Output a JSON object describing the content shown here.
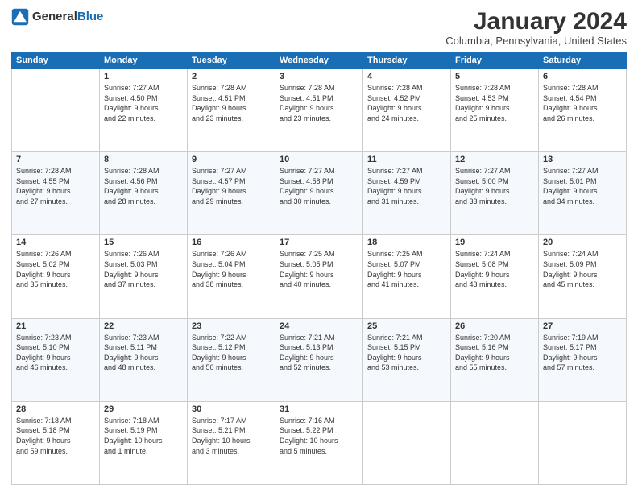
{
  "header": {
    "logo_general": "General",
    "logo_blue": "Blue",
    "title": "January 2024",
    "location": "Columbia, Pennsylvania, United States"
  },
  "weekdays": [
    "Sunday",
    "Monday",
    "Tuesday",
    "Wednesday",
    "Thursday",
    "Friday",
    "Saturday"
  ],
  "weeks": [
    [
      {
        "day": "",
        "info": ""
      },
      {
        "day": "1",
        "info": "Sunrise: 7:27 AM\nSunset: 4:50 PM\nDaylight: 9 hours\nand 22 minutes."
      },
      {
        "day": "2",
        "info": "Sunrise: 7:28 AM\nSunset: 4:51 PM\nDaylight: 9 hours\nand 23 minutes."
      },
      {
        "day": "3",
        "info": "Sunrise: 7:28 AM\nSunset: 4:51 PM\nDaylight: 9 hours\nand 23 minutes."
      },
      {
        "day": "4",
        "info": "Sunrise: 7:28 AM\nSunset: 4:52 PM\nDaylight: 9 hours\nand 24 minutes."
      },
      {
        "day": "5",
        "info": "Sunrise: 7:28 AM\nSunset: 4:53 PM\nDaylight: 9 hours\nand 25 minutes."
      },
      {
        "day": "6",
        "info": "Sunrise: 7:28 AM\nSunset: 4:54 PM\nDaylight: 9 hours\nand 26 minutes."
      }
    ],
    [
      {
        "day": "7",
        "info": "Sunrise: 7:28 AM\nSunset: 4:55 PM\nDaylight: 9 hours\nand 27 minutes."
      },
      {
        "day": "8",
        "info": "Sunrise: 7:28 AM\nSunset: 4:56 PM\nDaylight: 9 hours\nand 28 minutes."
      },
      {
        "day": "9",
        "info": "Sunrise: 7:27 AM\nSunset: 4:57 PM\nDaylight: 9 hours\nand 29 minutes."
      },
      {
        "day": "10",
        "info": "Sunrise: 7:27 AM\nSunset: 4:58 PM\nDaylight: 9 hours\nand 30 minutes."
      },
      {
        "day": "11",
        "info": "Sunrise: 7:27 AM\nSunset: 4:59 PM\nDaylight: 9 hours\nand 31 minutes."
      },
      {
        "day": "12",
        "info": "Sunrise: 7:27 AM\nSunset: 5:00 PM\nDaylight: 9 hours\nand 33 minutes."
      },
      {
        "day": "13",
        "info": "Sunrise: 7:27 AM\nSunset: 5:01 PM\nDaylight: 9 hours\nand 34 minutes."
      }
    ],
    [
      {
        "day": "14",
        "info": "Sunrise: 7:26 AM\nSunset: 5:02 PM\nDaylight: 9 hours\nand 35 minutes."
      },
      {
        "day": "15",
        "info": "Sunrise: 7:26 AM\nSunset: 5:03 PM\nDaylight: 9 hours\nand 37 minutes."
      },
      {
        "day": "16",
        "info": "Sunrise: 7:26 AM\nSunset: 5:04 PM\nDaylight: 9 hours\nand 38 minutes."
      },
      {
        "day": "17",
        "info": "Sunrise: 7:25 AM\nSunset: 5:05 PM\nDaylight: 9 hours\nand 40 minutes."
      },
      {
        "day": "18",
        "info": "Sunrise: 7:25 AM\nSunset: 5:07 PM\nDaylight: 9 hours\nand 41 minutes."
      },
      {
        "day": "19",
        "info": "Sunrise: 7:24 AM\nSunset: 5:08 PM\nDaylight: 9 hours\nand 43 minutes."
      },
      {
        "day": "20",
        "info": "Sunrise: 7:24 AM\nSunset: 5:09 PM\nDaylight: 9 hours\nand 45 minutes."
      }
    ],
    [
      {
        "day": "21",
        "info": "Sunrise: 7:23 AM\nSunset: 5:10 PM\nDaylight: 9 hours\nand 46 minutes."
      },
      {
        "day": "22",
        "info": "Sunrise: 7:23 AM\nSunset: 5:11 PM\nDaylight: 9 hours\nand 48 minutes."
      },
      {
        "day": "23",
        "info": "Sunrise: 7:22 AM\nSunset: 5:12 PM\nDaylight: 9 hours\nand 50 minutes."
      },
      {
        "day": "24",
        "info": "Sunrise: 7:21 AM\nSunset: 5:13 PM\nDaylight: 9 hours\nand 52 minutes."
      },
      {
        "day": "25",
        "info": "Sunrise: 7:21 AM\nSunset: 5:15 PM\nDaylight: 9 hours\nand 53 minutes."
      },
      {
        "day": "26",
        "info": "Sunrise: 7:20 AM\nSunset: 5:16 PM\nDaylight: 9 hours\nand 55 minutes."
      },
      {
        "day": "27",
        "info": "Sunrise: 7:19 AM\nSunset: 5:17 PM\nDaylight: 9 hours\nand 57 minutes."
      }
    ],
    [
      {
        "day": "28",
        "info": "Sunrise: 7:18 AM\nSunset: 5:18 PM\nDaylight: 9 hours\nand 59 minutes."
      },
      {
        "day": "29",
        "info": "Sunrise: 7:18 AM\nSunset: 5:19 PM\nDaylight: 10 hours\nand 1 minute."
      },
      {
        "day": "30",
        "info": "Sunrise: 7:17 AM\nSunset: 5:21 PM\nDaylight: 10 hours\nand 3 minutes."
      },
      {
        "day": "31",
        "info": "Sunrise: 7:16 AM\nSunset: 5:22 PM\nDaylight: 10 hours\nand 5 minutes."
      },
      {
        "day": "",
        "info": ""
      },
      {
        "day": "",
        "info": ""
      },
      {
        "day": "",
        "info": ""
      }
    ]
  ]
}
